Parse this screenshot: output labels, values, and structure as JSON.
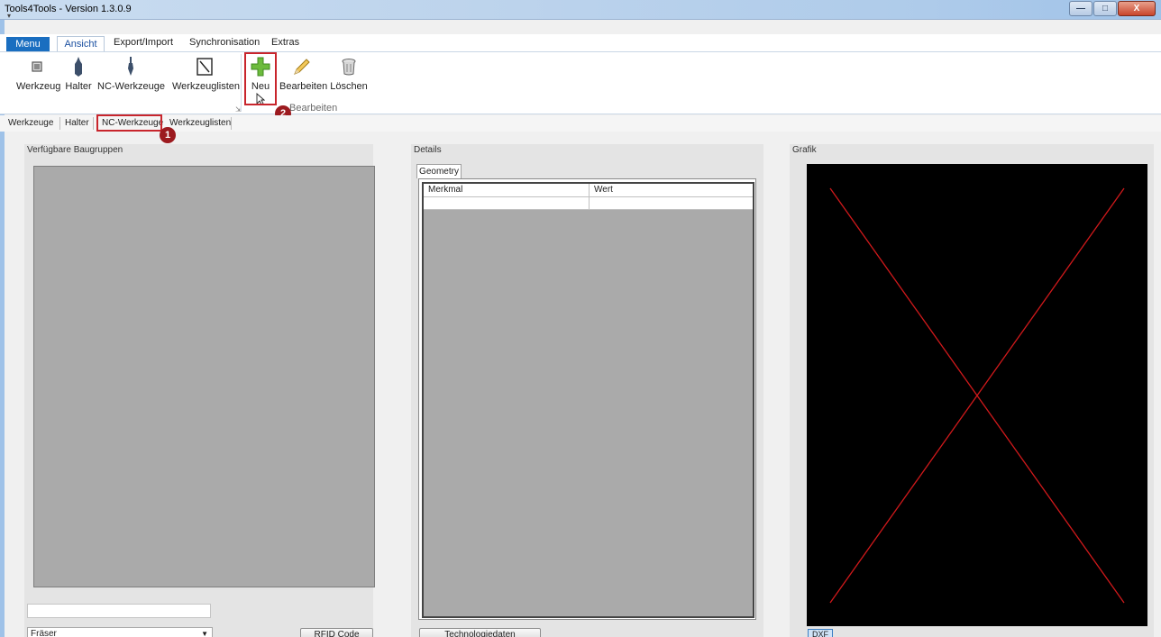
{
  "window": {
    "title": "Tools4Tools - Version 1.3.0.9",
    "qat_glyph": "▾",
    "minimize": "—",
    "maximize": "□",
    "close": "X"
  },
  "ribbon_tabs": [
    "Menu",
    "Ansicht",
    "Export/Import",
    "Synchronisation",
    "Extras"
  ],
  "ribbon": {
    "buttons": {
      "werkzeug": "Werkzeug",
      "halter": "Halter",
      "nc_werkzeuge": "NC-Werkzeuge",
      "werkzeuglisten": "Werkzeuglisten",
      "neu": "Neu",
      "bearbeiten": "Bearbeiten",
      "loeschen": "Löschen"
    },
    "group_label_bearbeiten": "Bearbeiten"
  },
  "annotations": {
    "badge1": "1",
    "badge2": "2"
  },
  "sub_tabs": [
    "Werkzeuge",
    "Halter",
    "NC-Werkzeuge",
    "Werkzeuglisten"
  ],
  "left_panel": {
    "title": "Verfügbare Baugruppen",
    "input_value": "",
    "combo_value": "Fräser",
    "rfid_button": "RFID Code"
  },
  "middle_panel": {
    "title": "Details",
    "tab": "Geometry",
    "columns": [
      "Merkmal",
      "Wert"
    ],
    "rows": [
      [
        "",
        ""
      ]
    ],
    "tech_button": "Technologiedaten"
  },
  "right_panel": {
    "title": "Grafik",
    "dxf_button": "DXF"
  },
  "colors": {
    "accent_blue": "#1a6ec0",
    "highlight_red": "#c8252c",
    "badge_red": "#9c1a1f",
    "placeholder_x": "#d0191b"
  },
  "icons": {
    "werkzeug": "tool-icon",
    "halter": "holder-icon",
    "nc_werkzeuge": "nc-tool-icon",
    "werkzeuglisten": "tool-list-icon",
    "neu": "plus-icon",
    "bearbeiten": "pencil-icon",
    "loeschen": "trash-icon"
  }
}
